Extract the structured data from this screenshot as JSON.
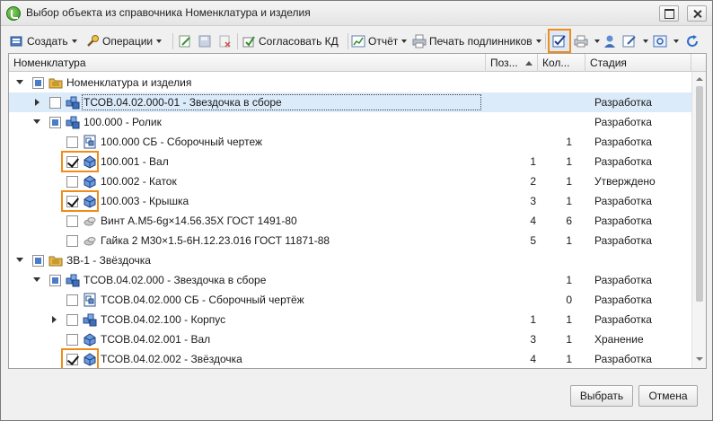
{
  "window": {
    "title": "Выбор объекта из справочника Номенклатура и изделия"
  },
  "toolbar": {
    "create": "Создать",
    "operations": "Операции",
    "approve": "Согласовать КД",
    "report": "Отчёт",
    "print": "Печать подлинников"
  },
  "columns": {
    "name": "Номенклатура",
    "pos": "Поз...",
    "qty": "Кол...",
    "stage": "Стадия"
  },
  "rows": [
    {
      "name": "Номенклатура и изделия",
      "pos": "",
      "qty": "",
      "stage": "",
      "check": "partial",
      "icon": "folder-icon",
      "expand": "open",
      "level": 0
    },
    {
      "name": "ТСОВ.04.02.000-01 - Звездочка в сборе",
      "pos": "",
      "qty": "",
      "stage": "Разработка",
      "check": "empty",
      "icon": "assembly-icon",
      "expand": "closed",
      "level": 1
    },
    {
      "name": "100.000 - Ролик",
      "pos": "",
      "qty": "",
      "stage": "Разработка",
      "check": "partial",
      "icon": "assembly-icon",
      "expand": "open",
      "level": 1
    },
    {
      "name": "100.000 СБ - Сборочный чертеж",
      "pos": "",
      "qty": "1",
      "stage": "Разработка",
      "check": "empty",
      "icon": "drawing-icon",
      "expand": "none",
      "level": 2
    },
    {
      "name": "100.001 - Вал",
      "pos": "1",
      "qty": "1",
      "stage": "Разработка",
      "check": "checked",
      "icon": "part-icon",
      "expand": "none",
      "level": 2,
      "highlight": true
    },
    {
      "name": "100.002 - Каток",
      "pos": "2",
      "qty": "1",
      "stage": "Утверждено",
      "check": "empty",
      "icon": "part-icon",
      "expand": "none",
      "level": 2
    },
    {
      "name": "100.003 - Крышка",
      "pos": "3",
      "qty": "1",
      "stage": "Разработка",
      "check": "checked",
      "icon": "part-icon",
      "expand": "none",
      "level": 2,
      "highlight": true
    },
    {
      "name": "Винт А.М5-6g×14.56.35Х ГОСТ 1491-80",
      "pos": "4",
      "qty": "6",
      "stage": "Разработка",
      "check": "empty",
      "icon": "standard-icon",
      "expand": "none",
      "level": 2
    },
    {
      "name": "Гайка 2 М30×1.5-6Н.12.23.016 ГОСТ 11871-88",
      "pos": "5",
      "qty": "1",
      "stage": "Разработка",
      "check": "empty",
      "icon": "standard-icon",
      "expand": "none",
      "level": 2
    },
    {
      "name": "ЗВ-1 - Звёздочка",
      "pos": "",
      "qty": "",
      "stage": "",
      "check": "partial",
      "icon": "folder-icon",
      "expand": "open",
      "level": 0
    },
    {
      "name": "ТСОВ.04.02.000 - Звездочка в сборе",
      "pos": "",
      "qty": "1",
      "stage": "Разработка",
      "check": "partial",
      "icon": "assembly-icon",
      "expand": "open",
      "level": 1
    },
    {
      "name": "ТСОВ.04.02.000 СБ - Сборочный чертёж",
      "pos": "",
      "qty": "0",
      "stage": "Разработка",
      "check": "empty",
      "icon": "drawing-icon",
      "expand": "none",
      "level": 2
    },
    {
      "name": "ТСОВ.04.02.100 - Корпус",
      "pos": "1",
      "qty": "1",
      "stage": "Разработка",
      "check": "empty",
      "icon": "assembly-icon",
      "expand": "closed",
      "level": 2
    },
    {
      "name": "ТСОВ.04.02.001 - Вал",
      "pos": "3",
      "qty": "1",
      "stage": "Хранение",
      "check": "empty",
      "icon": "part-icon",
      "expand": "none",
      "level": 2
    },
    {
      "name": "ТСОВ.04.02.002 - Звёздочка",
      "pos": "4",
      "qty": "1",
      "stage": "Разработка",
      "check": "checked",
      "icon": "part-icon",
      "expand": "none",
      "level": 2,
      "highlight": true
    }
  ],
  "buttons": {
    "ok": "Выбрать",
    "cancel": "Отмена"
  },
  "colors": {
    "highlight": "#f08c1a",
    "selection": "#dcebfa",
    "accent": "#4a7cc9"
  }
}
